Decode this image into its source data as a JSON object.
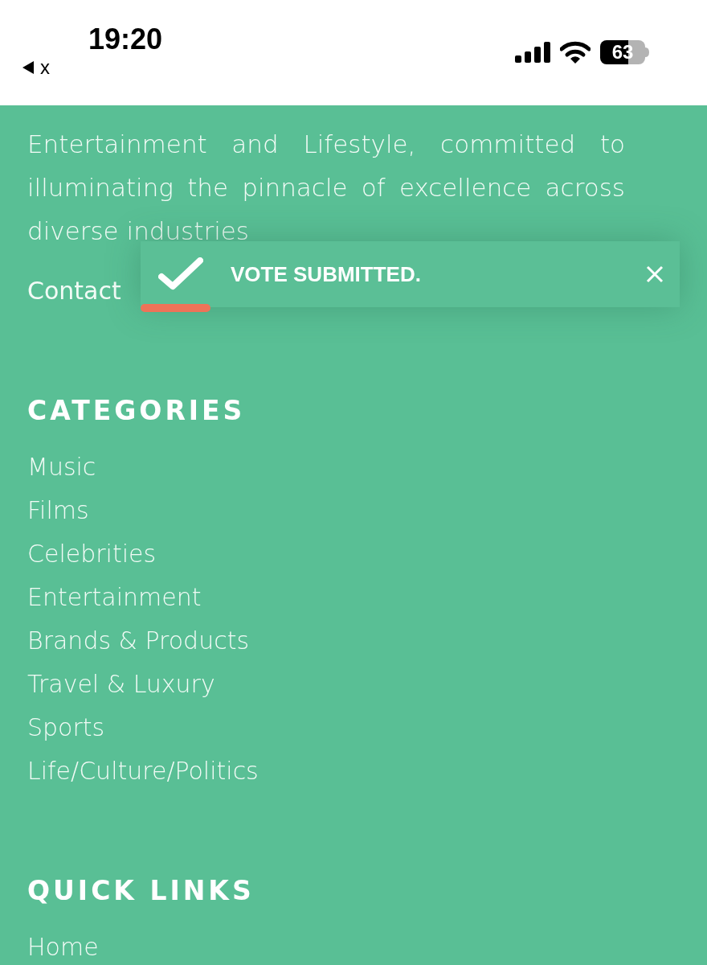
{
  "status_bar": {
    "time": "19:20",
    "back_label": "x",
    "battery": "63"
  },
  "about": {
    "text": "Entertainment and Lifestyle, committed to illuminating the pinnacle of excellence across diverse industries",
    "link": "Contact"
  },
  "toast": {
    "message": "VOTE SUBMITTED.",
    "level": 0.13
  },
  "categories": {
    "heading": "CATEGORIES",
    "items": [
      "Music",
      "Films",
      "Celebrities",
      "Entertainment",
      "Brands & Products",
      "Travel & Luxury",
      "Sports",
      "Life/Culture/Politics"
    ]
  },
  "quick_links": {
    "heading": "QUICK LINKS",
    "items": [
      "Home"
    ]
  }
}
